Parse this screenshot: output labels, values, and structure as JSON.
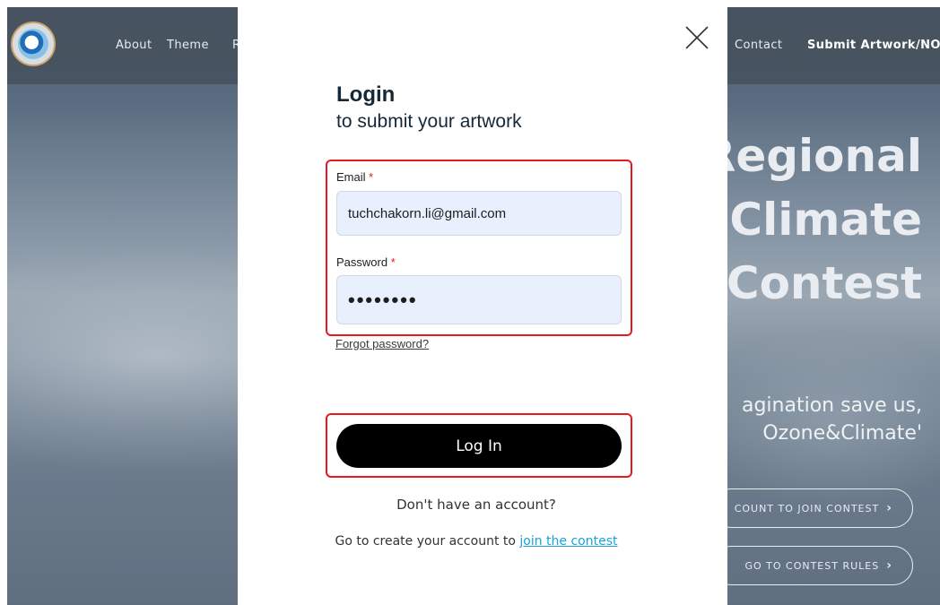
{
  "nav": {
    "about": "About",
    "theme": "Theme",
    "theme_cut": "R",
    "contact": "Contact",
    "submit": "Submit Artwork/NOU"
  },
  "hero": {
    "title_line1": "Regional",
    "title_line2": "&Climate",
    "title_line3": "Contest",
    "sub_line1": "agination save us,",
    "sub_line2": "Ozone&Climate'",
    "btn1": "COUNT TO JOIN CONTEST",
    "btn2": "GO TO CONTEST RULES",
    "chevron": "›"
  },
  "modal": {
    "title": "Login",
    "subtitle": "to submit your artwork",
    "email_label": "Email",
    "email_value": "tuchchakorn.li@gmail.com",
    "password_label": "Password",
    "password_value": "••••••••",
    "required_mark": "*",
    "forgot": "Forgot password?",
    "login_button": "Log In",
    "no_account": "Don't have an account?",
    "create_prefix": "Go to create your account to",
    "create_link": "join the contest"
  },
  "colors": {
    "accent": "#1aa3d9",
    "highlight_frame": "#e8191e",
    "button_bg": "#000000"
  },
  "icons": {
    "close": "close-icon",
    "logo": "o3-logo"
  }
}
